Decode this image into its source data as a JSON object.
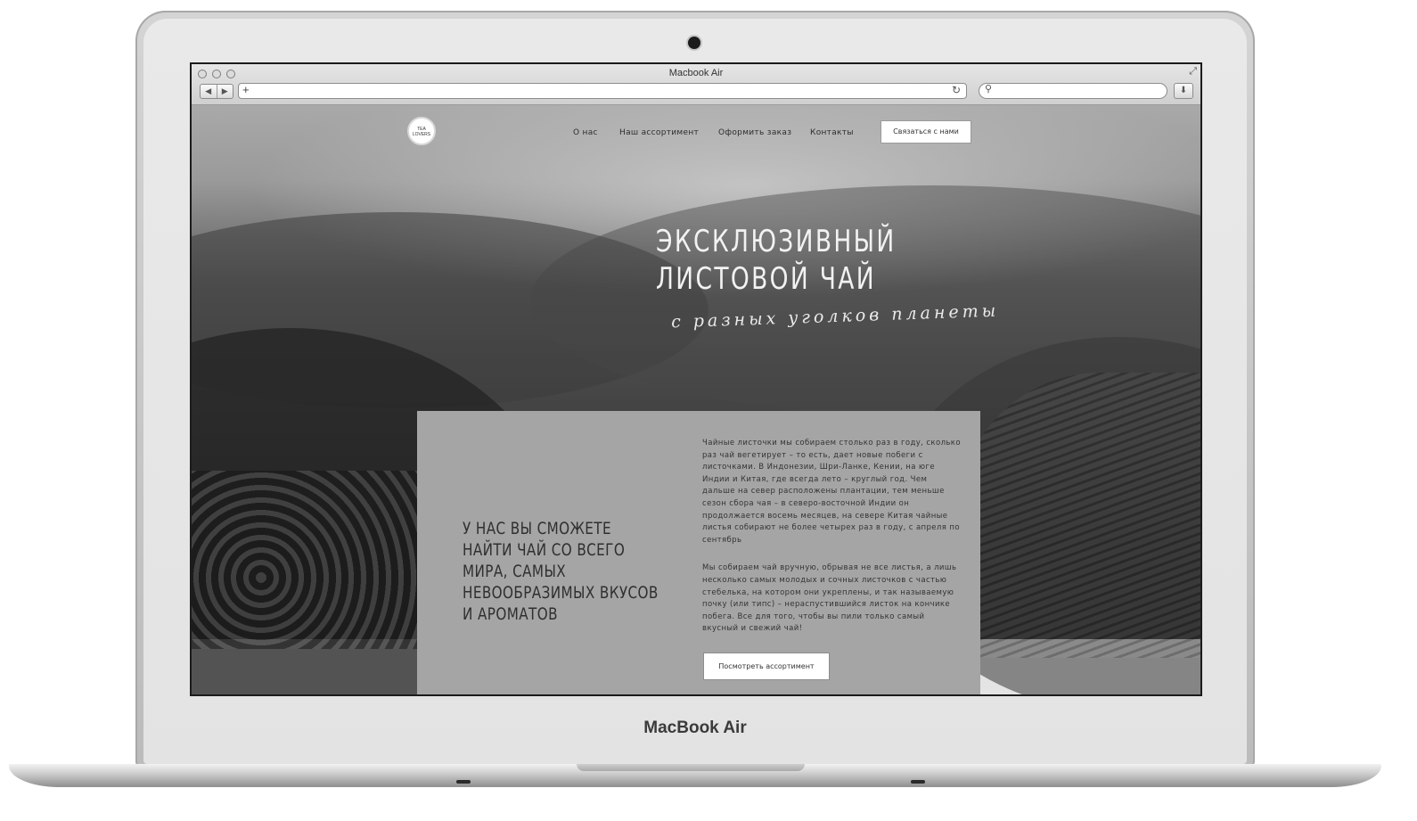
{
  "device": {
    "brand_label": "MacBook Air"
  },
  "browser": {
    "window_title": "Macbook Air",
    "address_value": "",
    "search_value": "",
    "new_tab_glyph": "+",
    "back_glyph": "◀",
    "forward_glyph": "▶",
    "reload_glyph": "↻",
    "search_glyph": "🔍",
    "download_glyph": "⬇",
    "resize_glyph": "⤢"
  },
  "site": {
    "logo": {
      "line1": "TEA",
      "line2": "LOVERS"
    },
    "nav": [
      {
        "label": "О нас"
      },
      {
        "label": "Наш ассортимент"
      },
      {
        "label": "Оформить заказ"
      },
      {
        "label": "Контакты"
      }
    ],
    "contact_button": "Связаться с нами",
    "hero": {
      "title_line1": "ЭКСКЛЮЗИВНЫЙ",
      "title_line2": "ЛИСТОВОЙ ЧАЙ",
      "subtitle": "с разных уголков планеты"
    },
    "card": {
      "heading": "У нас вы сможете найти чай со всего мира, самых невообразимых вкусов и ароматов",
      "paragraph1": "Чайные листочки мы собираем столько раз в году, сколько раз чай вегетирует – то есть, дает новые побеги с листочками. В Индонезии, Шри-Ланке, Кении, на юге Индии и Китая, где всегда лето – круглый год. Чем дальше на север расположены плантации, тем меньше сезон сбора чая – в северо-восточной Индии он продолжается восемь месяцев, на севере Китая чайные листья собирают не более четырех раз в году, с апреля по сентябрь",
      "paragraph2": "Мы собираем чай вручную, обрывая не все листья, а лишь несколько самых молодых и сочных листочков с частью стебелька, на котором они укреплены, и так называемую почку (или типс) – нераспустившийся листок на кончике побега. Все для того, чтобы вы пили только самый вкусный и свежий чай!",
      "button": "Посмотреть ассортимент"
    }
  }
}
